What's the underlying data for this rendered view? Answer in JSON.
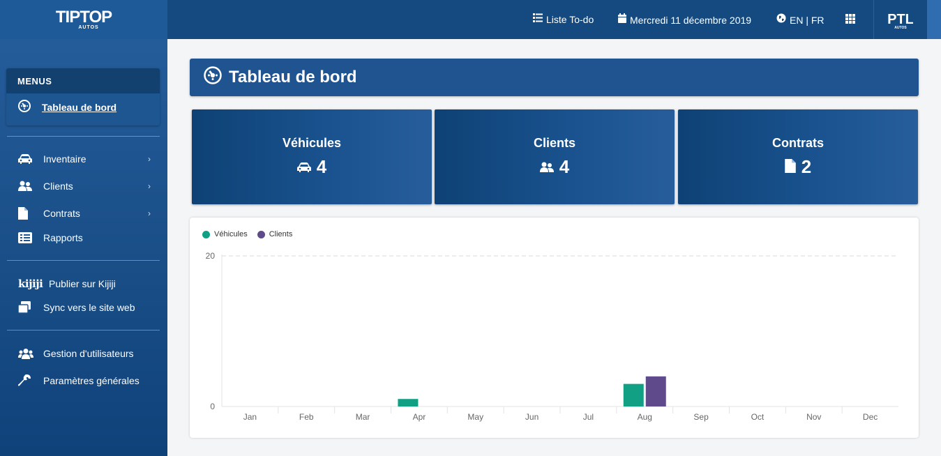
{
  "app": {
    "logo_text": "TIPTOP",
    "logo_sub": "AUTOS"
  },
  "topbar": {
    "todo_label": "Liste To-do",
    "date_label": "Mercredi 11 décembre 2019",
    "lang_label": "EN | FR",
    "avatar_text": "PTL"
  },
  "sidebar": {
    "menus_header": "MENUS",
    "active_item": "Tableau de bord",
    "items": [
      {
        "label": "Inventaire",
        "icon": "car-icon",
        "has_submenu": true
      },
      {
        "label": "Clients",
        "icon": "users-icon",
        "has_submenu": true
      },
      {
        "label": "Contrats",
        "icon": "file-icon",
        "has_submenu": true
      },
      {
        "label": "Rapports",
        "icon": "list-icon",
        "has_submenu": false
      },
      {
        "label": "Publier sur Kijiji",
        "icon": "kijiji-icon",
        "has_submenu": false
      },
      {
        "label": "Sync vers le site web",
        "icon": "sync-icon",
        "has_submenu": false
      },
      {
        "label": "Gestion d'utilisateurs",
        "icon": "users-group-icon",
        "has_submenu": false
      },
      {
        "label": "Paramètres générales",
        "icon": "wrench-icon",
        "has_submenu": false
      }
    ],
    "kijiji_text": "kijiji"
  },
  "main": {
    "title": "Tableau de bord",
    "cards": [
      {
        "title": "Véhicules",
        "value": "4"
      },
      {
        "title": "Clients",
        "value": "4"
      },
      {
        "title": "Contrats",
        "value": "2"
      }
    ]
  },
  "colors": {
    "vehicles": "#12a085",
    "clients": "#5f4b8b"
  },
  "chart_data": {
    "type": "bar",
    "categories": [
      "Jan",
      "Feb",
      "Mar",
      "Apr",
      "May",
      "Jun",
      "Jul",
      "Aug",
      "Sep",
      "Oct",
      "Nov",
      "Dec"
    ],
    "series": [
      {
        "name": "Véhicules",
        "values": [
          0,
          0,
          0,
          1,
          0,
          0,
          0,
          3,
          0,
          0,
          0,
          0
        ]
      },
      {
        "name": "Clients",
        "values": [
          0,
          0,
          0,
          0,
          0,
          0,
          0,
          4,
          0,
          0,
          0,
          0
        ]
      }
    ],
    "ylim": [
      0,
      20
    ],
    "yticks": [
      "0",
      "20"
    ],
    "legend": "top-left",
    "grid": true
  }
}
